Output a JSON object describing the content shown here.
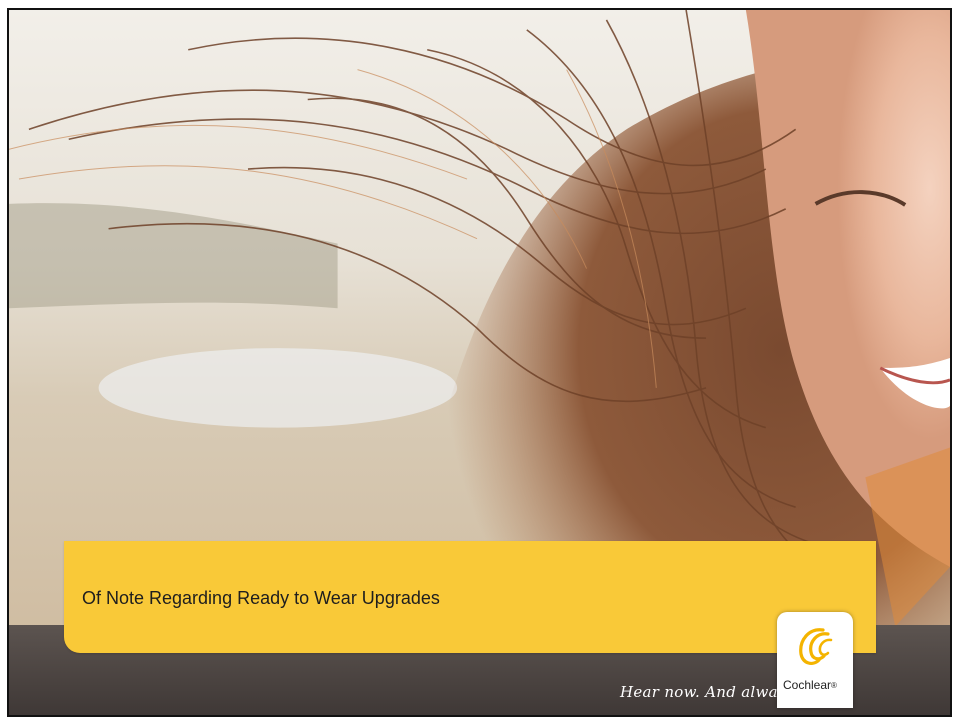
{
  "slide": {
    "title": "Of Note Regarding Ready to Wear Upgrades",
    "tagline": "Hear now. And always",
    "brand": "Cochlear",
    "brand_mark": "®"
  },
  "colors": {
    "title_box": "#f9c938",
    "bottom_band": "#4a4240",
    "text": "#1e1e1e"
  },
  "icons": {
    "logo": "cochlear-swirl-logo"
  }
}
